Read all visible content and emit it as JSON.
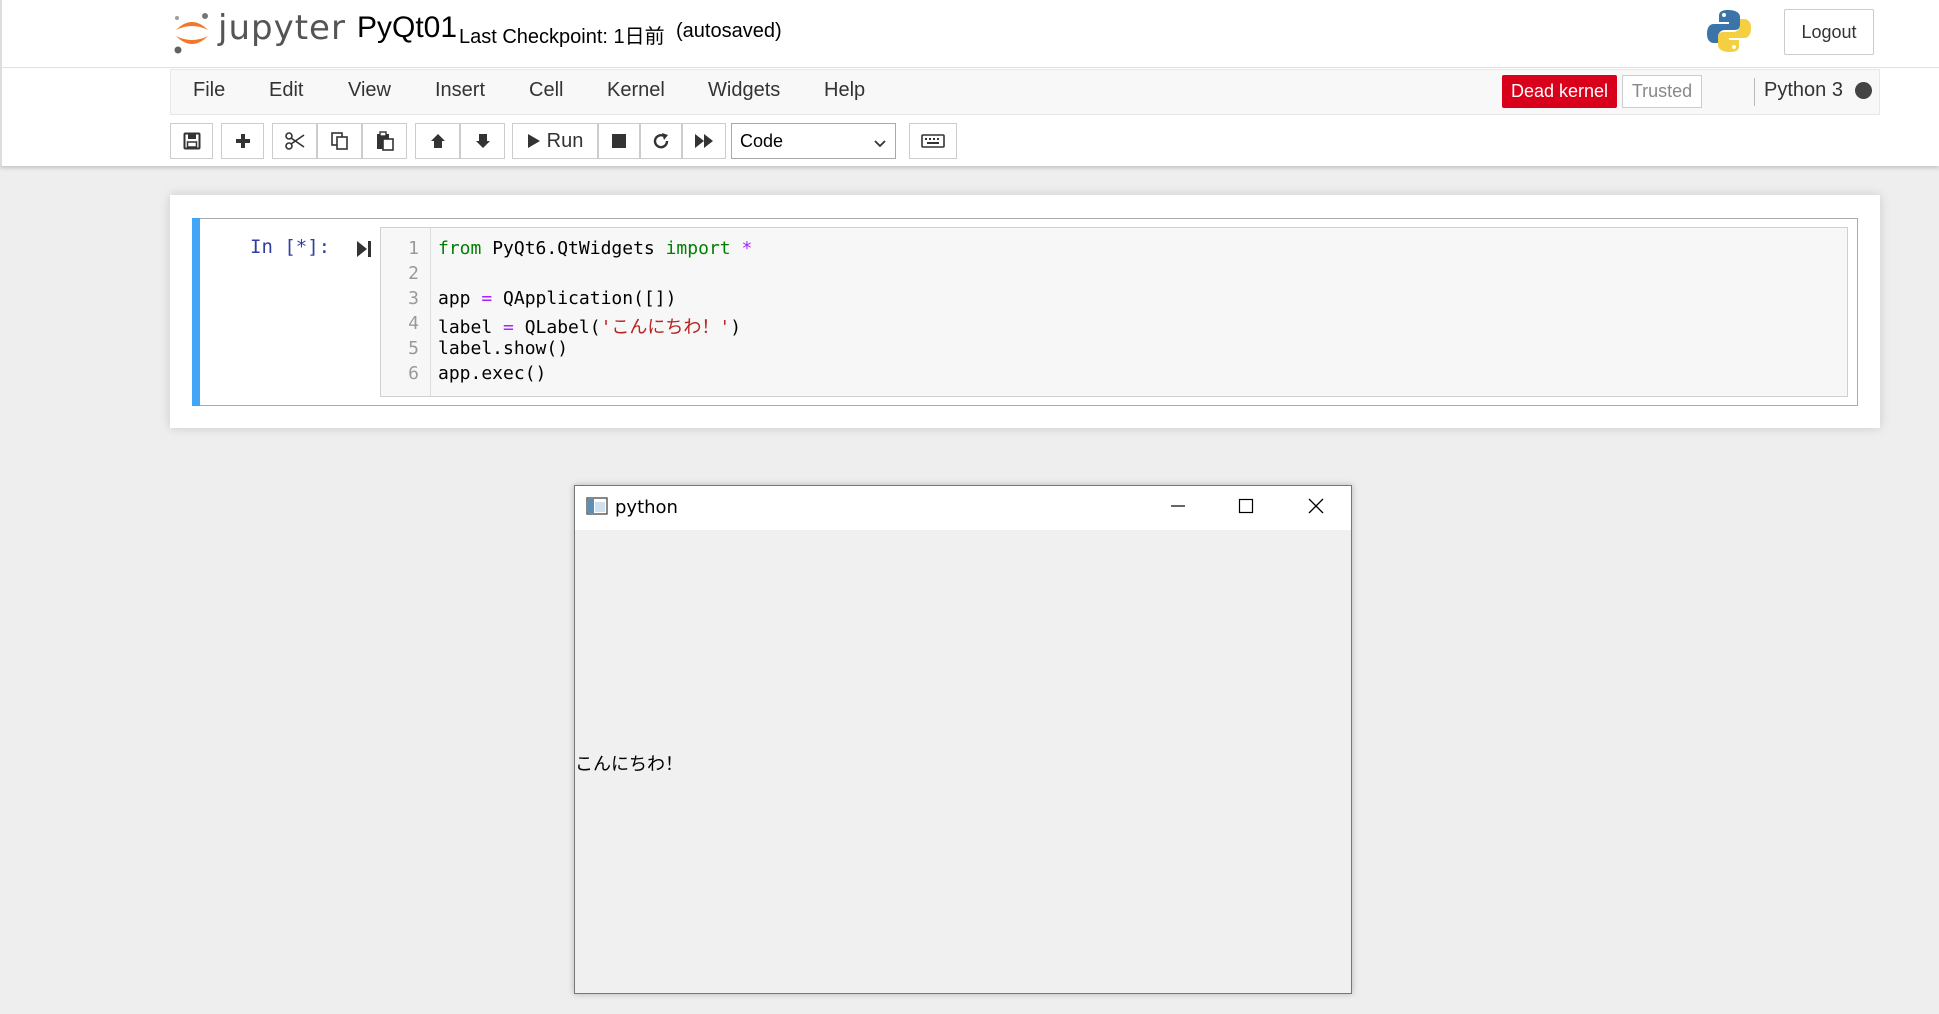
{
  "header": {
    "logo_text": "jupyter",
    "notebook_name": "PyQt01",
    "checkpoint": "Last Checkpoint: 1日前",
    "autosave_status": "(autosaved)",
    "logout_label": "Logout"
  },
  "menubar": {
    "items": [
      "File",
      "Edit",
      "View",
      "Insert",
      "Cell",
      "Kernel",
      "Widgets",
      "Help"
    ],
    "dead_kernel": "Dead kernel",
    "trusted": "Trusted",
    "kernel_name": "Python 3"
  },
  "toolbar": {
    "run_label": "Run",
    "cell_type": "Code"
  },
  "cell": {
    "prompt": "In [*]:",
    "line_numbers": [
      "1",
      "2",
      "3",
      "4",
      "5",
      "6"
    ],
    "code_lines": [
      "from PyQt6.QtWidgets import *",
      "",
      "app = QApplication([])",
      "label = QLabel('こんにちわ！')",
      "label.show()",
      "app.exec()"
    ],
    "tokens": {
      "from": "from",
      "module": " PyQt6.QtWidgets ",
      "import": "import",
      "star": " *",
      "app_assign": "app ",
      "eq1": "=",
      "qapp": " QApplication([])",
      "label_assign": "label ",
      "eq2": "=",
      "qlabel_open": " QLabel(",
      "string": "'こんにちわ！'",
      "close_paren": ")",
      "show": "label.show()",
      "exec": "app.exec()"
    }
  },
  "qt_window": {
    "title": "python",
    "label_text": "こんにちわ！"
  },
  "colors": {
    "cell_accent": "#42a5f5",
    "dead_kernel_bg": "#d9001b",
    "keyword": "#008000",
    "operator": "#aa22ff",
    "string": "#ba2121"
  }
}
